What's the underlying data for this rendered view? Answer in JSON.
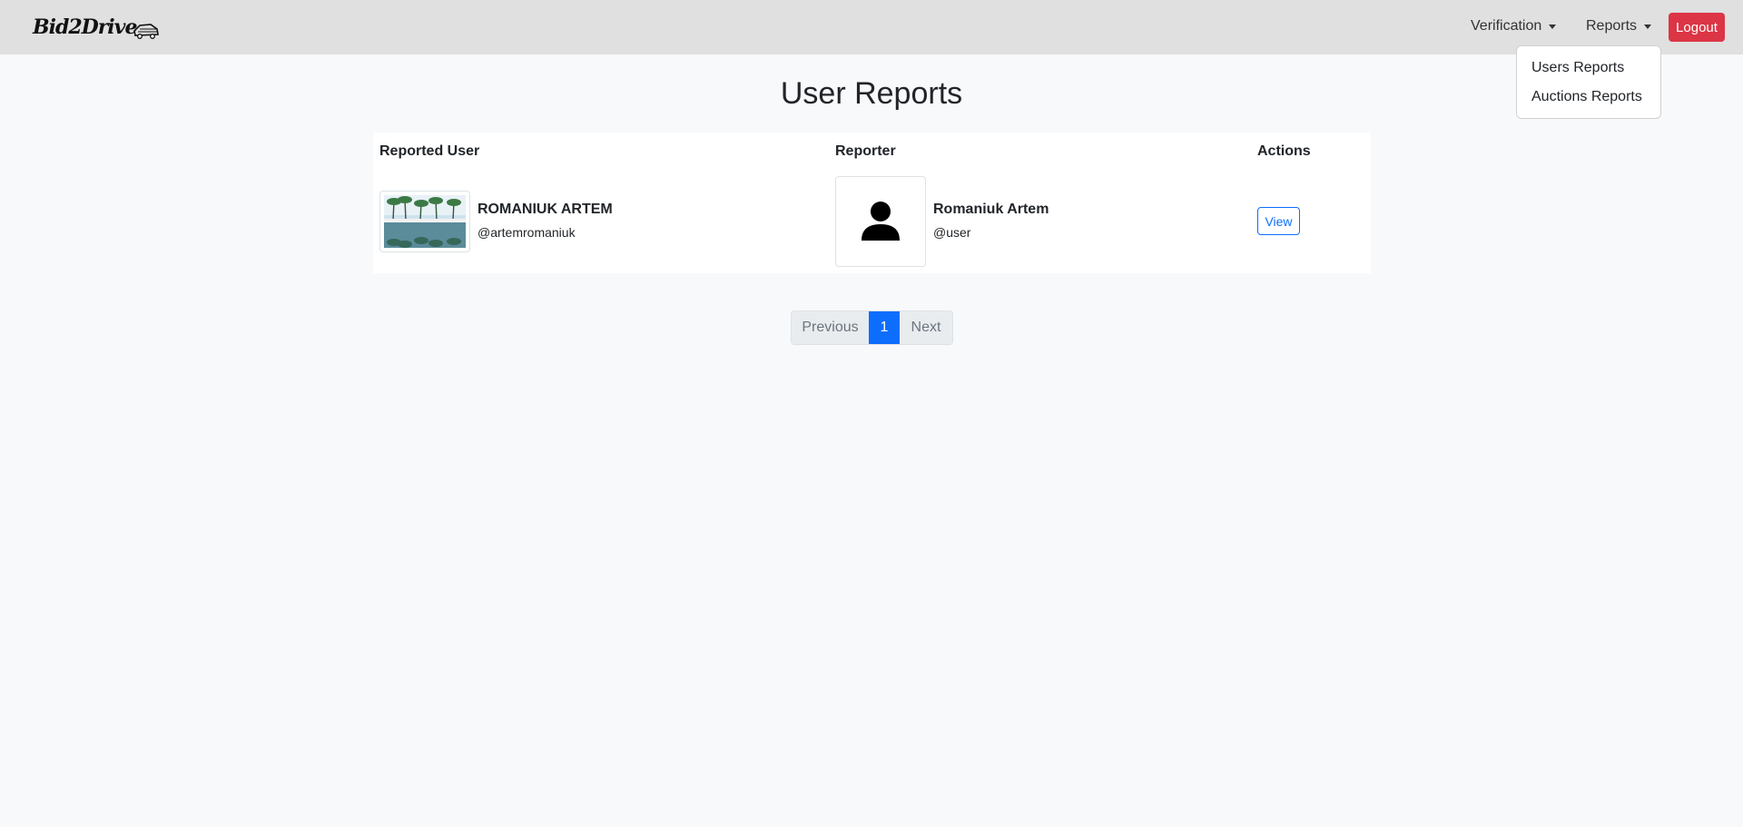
{
  "navbar": {
    "brand": "Bid2Drive",
    "verification_label": "Verification",
    "reports_label": "Reports",
    "logout_label": "Logout"
  },
  "reports_menu": {
    "items": [
      "Users Reports",
      "Auctions Reports"
    ]
  },
  "page": {
    "title": "User Reports"
  },
  "table": {
    "headers": {
      "reported_user": "Reported User",
      "reporter": "Reporter",
      "actions": "Actions"
    },
    "rows": [
      {
        "reported_user": {
          "name": "ROMANIUK ARTEM",
          "handle": "@artemromaniuk"
        },
        "reporter": {
          "name": "Romaniuk Artem",
          "handle": "@user"
        },
        "action_label": "View"
      }
    ]
  },
  "pagination": {
    "previous": "Previous",
    "current": "1",
    "next": "Next"
  },
  "colors": {
    "navbar_bg": "#e0e0e0",
    "logout": "#dc3545",
    "primary": "#0d6efd",
    "page_bg": "#f8f9fa"
  }
}
